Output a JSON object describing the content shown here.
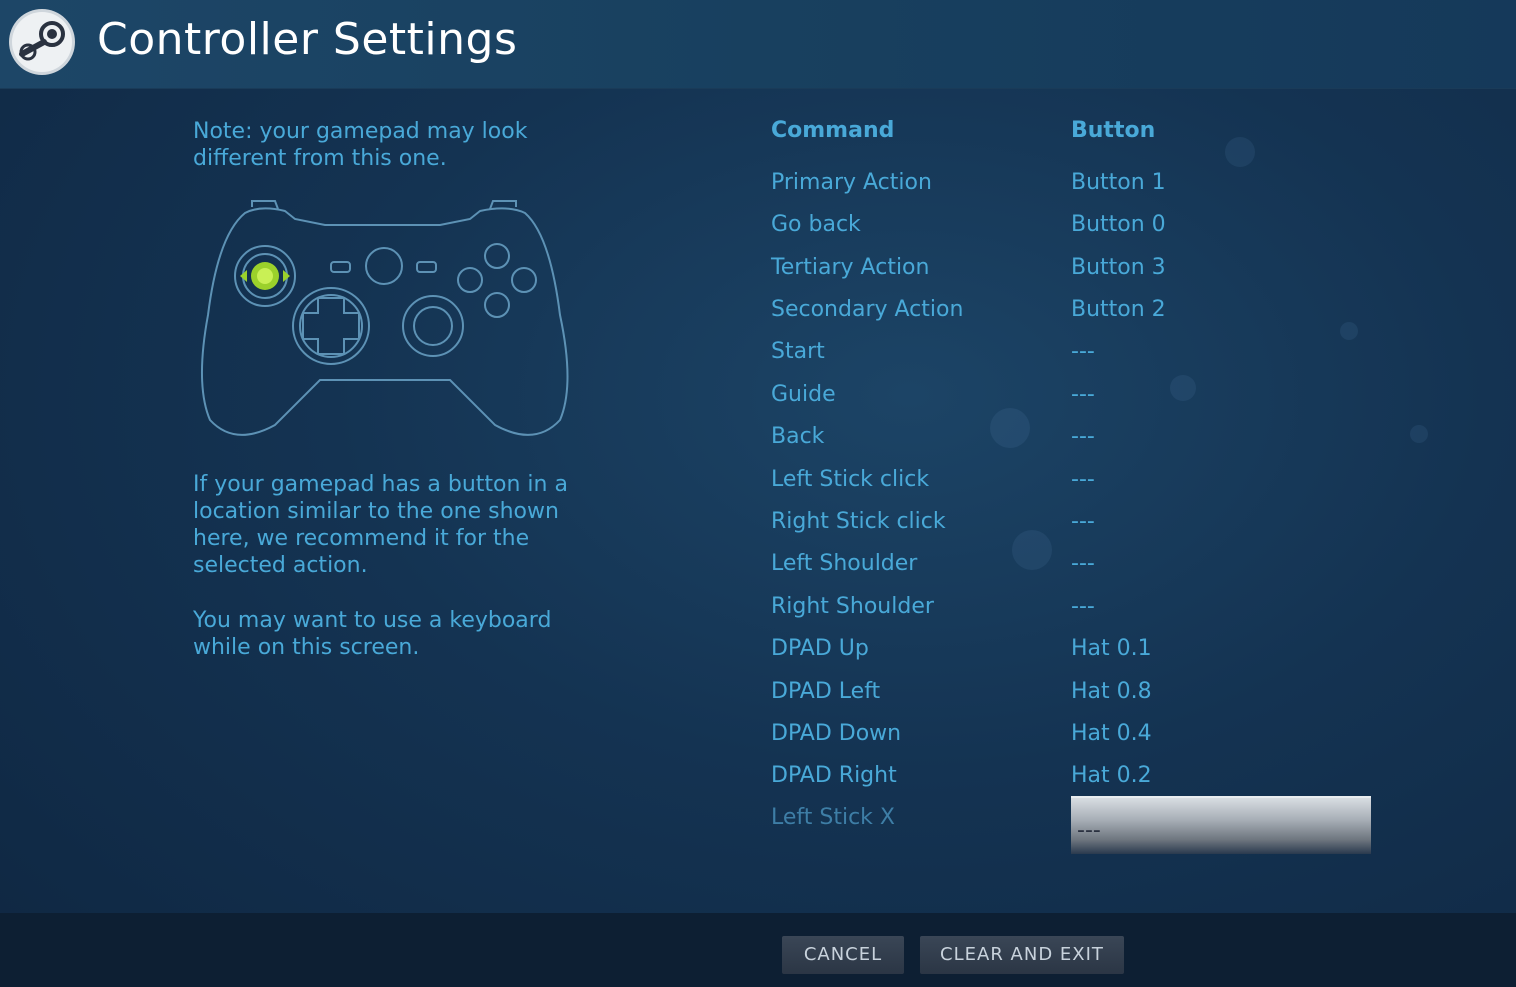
{
  "header": {
    "title": "Controller Settings",
    "logo_icon": "steam-logo-icon"
  },
  "left": {
    "note": "Note: your gamepad may look\ndifferent from this one.",
    "help": "If your gamepad has a button in a\nlocation similar to the one shown\nhere, we recommend it for the\nselected action.",
    "help2": "You may want to use a keyboard\nwhile on this screen.",
    "highlight_color": "#9bd12b"
  },
  "table": {
    "col_command": "Command",
    "col_button": "Button",
    "rows": [
      {
        "command": "Primary Action",
        "button": "Button 1"
      },
      {
        "command": "Go back",
        "button": "Button 0"
      },
      {
        "command": "Tertiary Action",
        "button": "Button 3"
      },
      {
        "command": "Secondary Action",
        "button": "Button 2"
      },
      {
        "command": "Start",
        "button": "---"
      },
      {
        "command": "Guide",
        "button": "---"
      },
      {
        "command": "Back",
        "button": "---"
      },
      {
        "command": "Left Stick click",
        "button": "---"
      },
      {
        "command": "Right Stick click",
        "button": "---"
      },
      {
        "command": "Left Shoulder",
        "button": "---"
      },
      {
        "command": "Right Shoulder",
        "button": "---"
      },
      {
        "command": "DPAD Up",
        "button": "Hat 0.1"
      },
      {
        "command": "DPAD Left",
        "button": "Hat 0.8"
      },
      {
        "command": "DPAD Down",
        "button": "Hat 0.4"
      },
      {
        "command": "DPAD Right",
        "button": "Hat 0.2"
      },
      {
        "command": "Left Stick X",
        "button": "---"
      }
    ]
  },
  "footer": {
    "cancel": "CANCEL",
    "clear_exit": "CLEAR AND EXIT"
  }
}
